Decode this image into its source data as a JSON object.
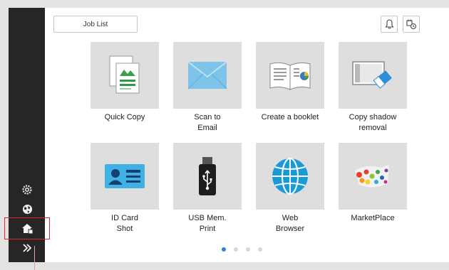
{
  "header": {
    "job_list_label": "Job List",
    "bell_icon": "bell-icon",
    "eco_icon": "eco-timer-icon"
  },
  "sidebar": {
    "items": [
      {
        "icon": "settings-gear-icon"
      },
      {
        "icon": "globe-icon"
      },
      {
        "icon": "home-icon",
        "selected": true
      },
      {
        "icon": "chevron-double-right-icon"
      }
    ]
  },
  "apps": [
    {
      "label": "Quick Copy",
      "icon": "quick-copy-icon"
    },
    {
      "label": "Scan to\nEmail",
      "icon": "envelope-icon"
    },
    {
      "label": "Create a booklet",
      "icon": "booklet-icon"
    },
    {
      "label": "Copy shadow\nremoval",
      "icon": "eraser-icon"
    },
    {
      "label": "ID Card\nShot",
      "icon": "id-card-icon"
    },
    {
      "label": "USB Mem.\nPrint",
      "icon": "usb-icon"
    },
    {
      "label": "Web\nBrowser",
      "icon": "globe-icon"
    },
    {
      "label": "MarketPlace",
      "icon": "marketplace-icon"
    }
  ],
  "pager": {
    "pages": 4,
    "current": 1
  },
  "colors": {
    "sidebar": "#262626",
    "tile": "#dedede",
    "accent": "#2a7fd6",
    "highlight": "#e0232c"
  }
}
